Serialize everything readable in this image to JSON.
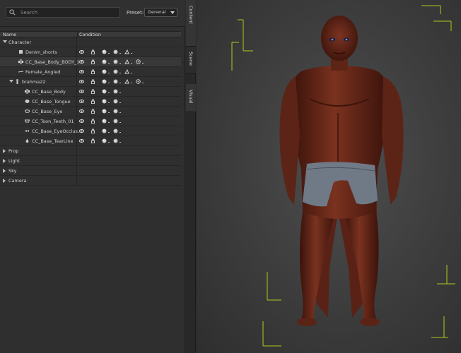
{
  "search": {
    "placeholder": "Search"
  },
  "preset": {
    "label": "Preset:",
    "value": "General"
  },
  "columns": {
    "name": "Name",
    "condition": "Condition"
  },
  "tree": [
    {
      "label": "Character",
      "indent": 0,
      "arrow": "down",
      "icon": "",
      "conditions": 0
    },
    {
      "label": "Denim_shorts",
      "indent": 2,
      "arrow": "",
      "icon": "cloth-icon",
      "conditions": 5
    },
    {
      "label": "CC_Base_Body_BODY_1",
      "indent": 2,
      "arrow": "",
      "icon": "body-mesh-icon",
      "conditions": 6,
      "selected": true
    },
    {
      "label": "Female_Angled",
      "indent": 2,
      "arrow": "",
      "icon": "hair-icon",
      "conditions": 5
    },
    {
      "label": "brahma22",
      "indent": 1,
      "arrow": "down",
      "icon": "figure-icon",
      "conditions": 6
    },
    {
      "label": "CC_Base_Body",
      "indent": 3,
      "arrow": "",
      "icon": "body-mesh-icon",
      "conditions": 4
    },
    {
      "label": "CC_Base_Tongue",
      "indent": 3,
      "arrow": "",
      "icon": "tongue-icon",
      "conditions": 4
    },
    {
      "label": "CC_Base_Eye",
      "indent": 3,
      "arrow": "",
      "icon": "eye-mesh-icon",
      "conditions": 4
    },
    {
      "label": "CC_Toon_Teeth_01",
      "indent": 3,
      "arrow": "",
      "icon": "teeth-icon",
      "conditions": 4
    },
    {
      "label": "CC_Base_EyeOcclus...",
      "indent": 3,
      "arrow": "",
      "icon": "eye-occlusion-icon",
      "conditions": 4
    },
    {
      "label": "CC_Base_TearLine",
      "indent": 3,
      "arrow": "",
      "icon": "tearline-icon",
      "conditions": 4
    },
    {
      "label": "Prop",
      "indent": 0,
      "arrow": "right",
      "icon": "",
      "conditions": 0
    },
    {
      "label": "Light",
      "indent": 0,
      "arrow": "right",
      "icon": "",
      "conditions": 0
    },
    {
      "label": "Sky",
      "indent": 0,
      "arrow": "right",
      "icon": "",
      "conditions": 0
    },
    {
      "label": "Camera",
      "indent": 0,
      "arrow": "right",
      "icon": "",
      "conditions": 0
    }
  ],
  "side_tabs": [
    "Content",
    "Scene",
    "Visual"
  ],
  "colors": {
    "bounding_box": "#b4c81e",
    "panel_bg": "#2f2f2f",
    "skin": "#6b2a1c"
  }
}
